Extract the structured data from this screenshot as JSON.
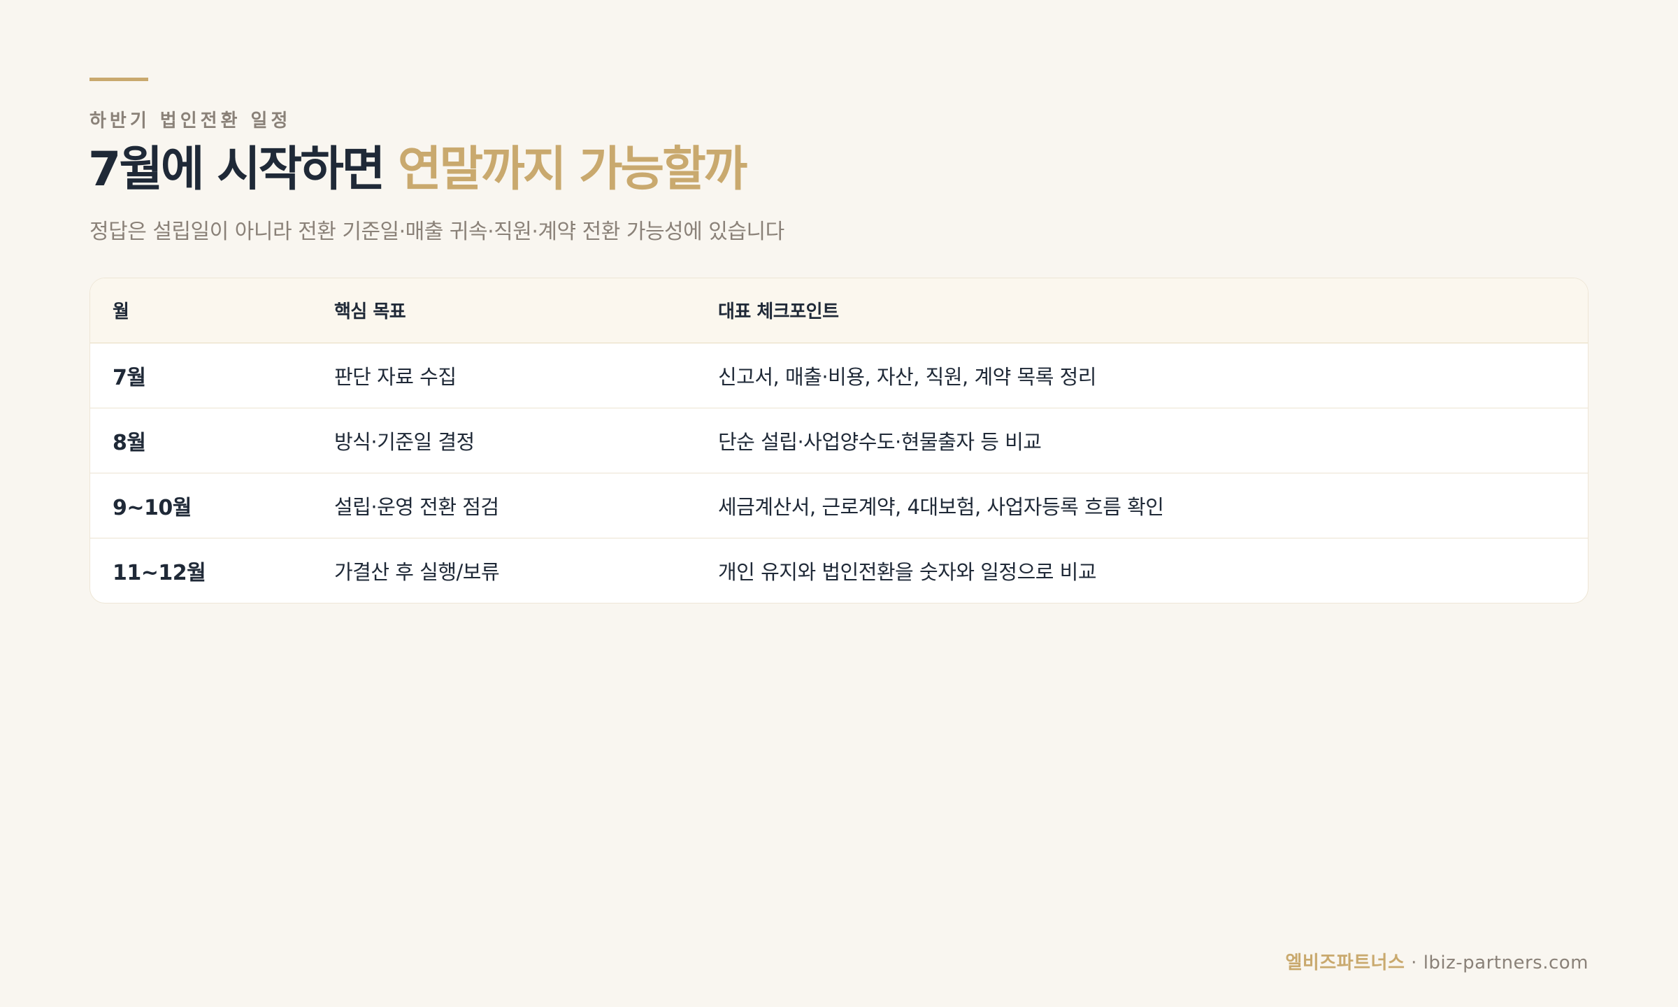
{
  "header": {
    "eyebrow": "하반기 법인전환 일정",
    "title_main": "7월에 시작하면 ",
    "title_highlight": "연말까지 가능할까",
    "subtitle": "정답은 설립일이 아니라 전환 기준일·매출 귀속·직원·계약 전환 가능성에 있습니다"
  },
  "table": {
    "columns": [
      "월",
      "핵심 목표",
      "대표 체크포인트"
    ],
    "rows": [
      {
        "month": "7월",
        "goal": "판단 자료 수집",
        "checkpoint": "신고서, 매출·비용, 자산, 직원, 계약 목록 정리"
      },
      {
        "month": "8월",
        "goal": "방식·기준일 결정",
        "checkpoint": "단순 설립·사업양수도·현물출자 등 비교"
      },
      {
        "month": "9~10월",
        "goal": "설립·운영 전환 점검",
        "checkpoint": "세금계산서, 근로계약, 4대보험, 사업자등록 흐름 확인"
      },
      {
        "month": "11~12월",
        "goal": "가결산 후 실행/보류",
        "checkpoint": "개인 유지와 법인전환을 숫자와 일정으로 비교"
      }
    ]
  },
  "footer": {
    "brand": "엘비즈파트너스",
    "separator": " · ",
    "url": "lbiz-partners.com"
  },
  "colors": {
    "background": "#f9f6f0",
    "accent": "#c9a96e",
    "text_dark": "#1f2937",
    "text_muted": "#8a8178"
  }
}
